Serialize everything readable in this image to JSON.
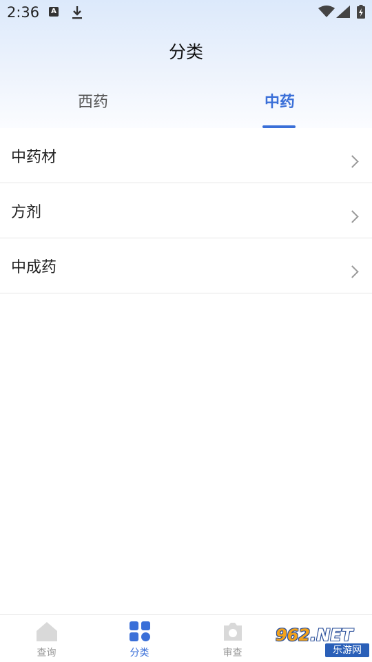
{
  "status_bar": {
    "time": "2:36",
    "icons": [
      "a-notification-icon",
      "download-icon",
      "wifi-icon",
      "cell-signal-icon",
      "battery-icon"
    ]
  },
  "header": {
    "title": "分类"
  },
  "tabs": [
    {
      "label": "西药",
      "active": false
    },
    {
      "label": "中药",
      "active": true
    }
  ],
  "list": {
    "items": [
      {
        "label": "中药材"
      },
      {
        "label": "方剂"
      },
      {
        "label": "中成药"
      }
    ]
  },
  "bottom_nav": {
    "items": [
      {
        "label": "查询",
        "icon": "home-icon",
        "active": false
      },
      {
        "label": "分类",
        "icon": "grid-icon",
        "active": true
      },
      {
        "label": "审查",
        "icon": "camera-icon",
        "active": false
      }
    ]
  },
  "watermark": {
    "top_num": "962",
    "top_suffix": ".NET",
    "bottom": "乐游网"
  },
  "colors": {
    "accent": "#3a6fd8",
    "inactive": "#9a9a9a"
  }
}
